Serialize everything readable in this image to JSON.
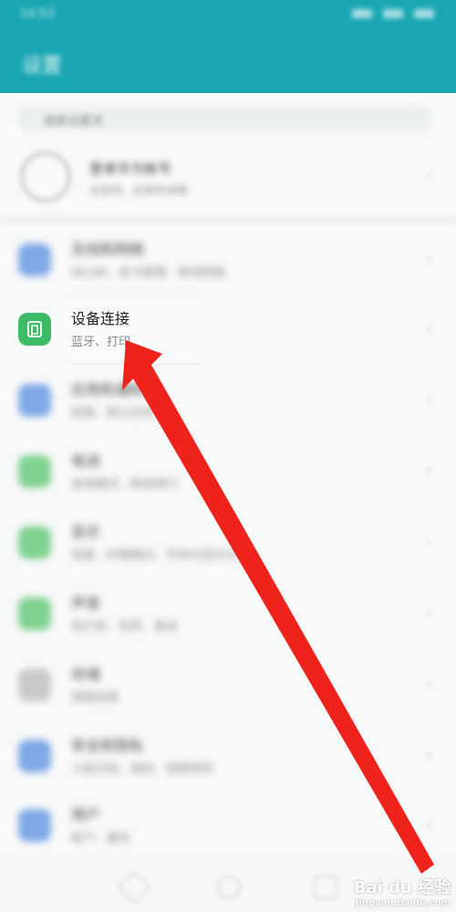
{
  "status_bar": {
    "time": "14:53"
  },
  "header": {
    "title": "设置"
  },
  "search": {
    "placeholder": "搜索设置项"
  },
  "account": {
    "title": "登录华为帐号",
    "subtitle": "云空间、应用市场等"
  },
  "rows": [
    {
      "name": "无线和网络",
      "sub": "WLAN、双卡管理、移动网络",
      "color": "#7ea8e6",
      "blurred": true
    },
    {
      "name": "设备连接",
      "sub": "蓝牙、打印",
      "color": "#3dbb67",
      "blurred": false
    },
    {
      "name": "应用和通知",
      "sub": "权限、默认应用",
      "color": "#7ea8e6",
      "blurred": true
    },
    {
      "name": "电池",
      "sub": "省电模式、耗电排行",
      "color": "#7fd18f",
      "blurred": true
    },
    {
      "name": "显示",
      "sub": "亮度、护眼模式、字体与显示大小",
      "color": "#7fd18f",
      "blurred": true
    },
    {
      "name": "声音",
      "sub": "免打扰、铃声、振动",
      "color": "#7fd18f",
      "blurred": true
    },
    {
      "name": "存储",
      "sub": "清理加速",
      "color": "#c9c9c9",
      "blurred": true
    },
    {
      "name": "安全和隐私",
      "sub": "人脸识别、指纹、锁屏密码",
      "color": "#7ea8e6",
      "blurred": true
    },
    {
      "name": "用户",
      "sub": "帐户、备份",
      "color": "#7ea8e6",
      "blurred": true
    }
  ],
  "annotation": {
    "color": "#f0221c"
  },
  "watermark": {
    "brand": "Bai du 经验",
    "url": "jingyan.baidu.com"
  }
}
